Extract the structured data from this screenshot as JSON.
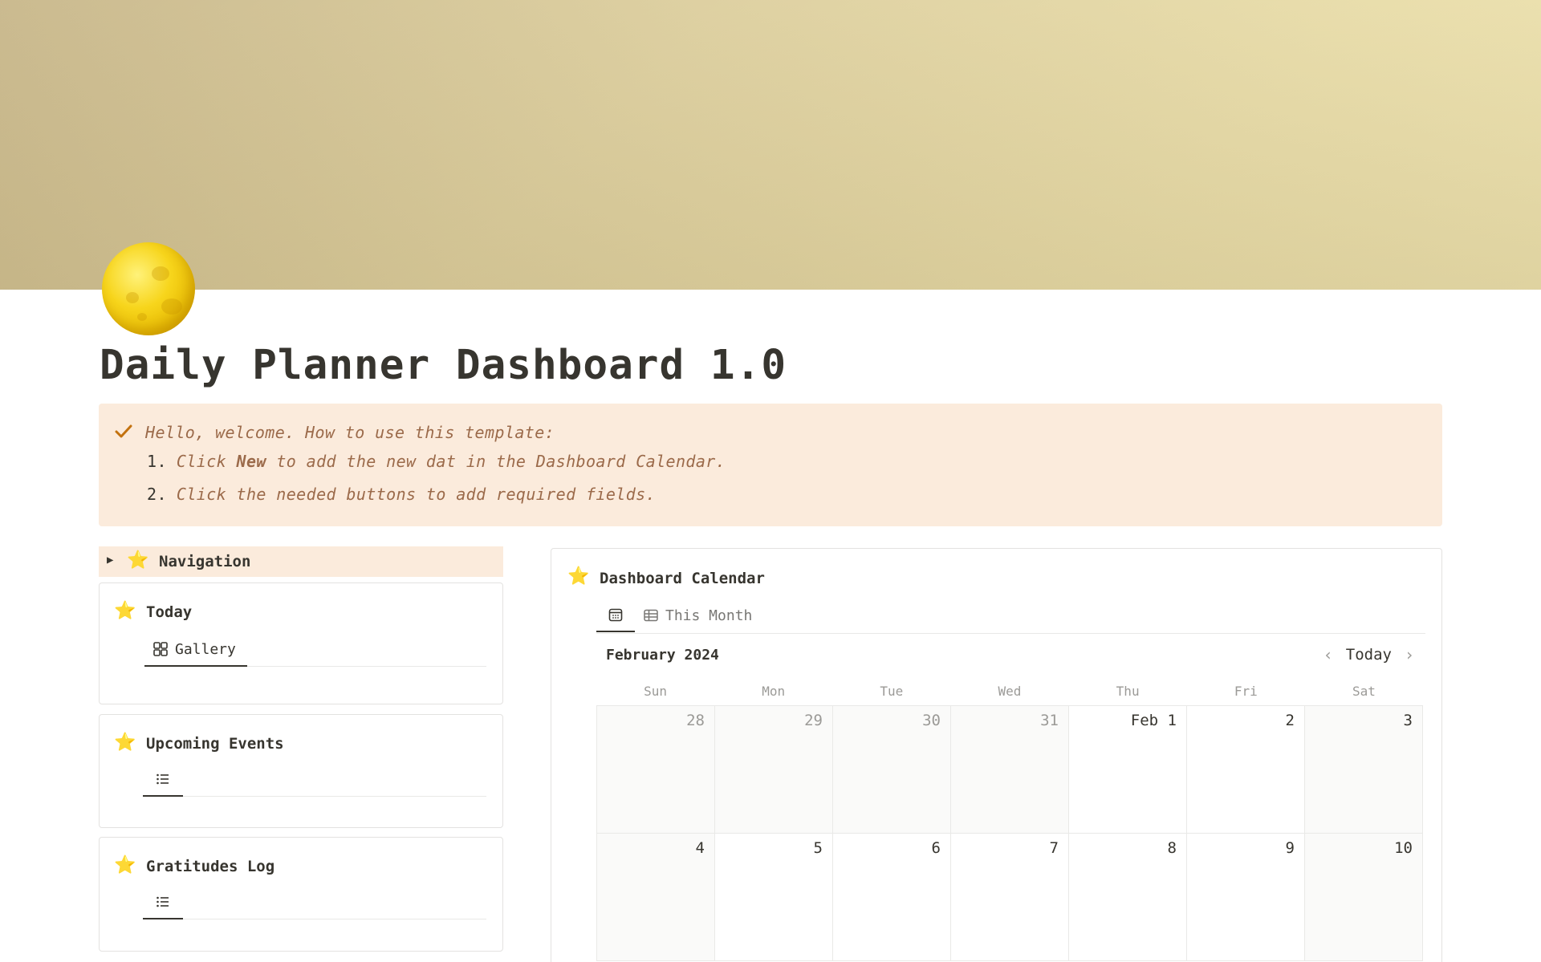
{
  "page": {
    "title": "Daily Planner Dashboard 1.0",
    "icon": "full-moon-icon"
  },
  "callout": {
    "icon": "checkmark-icon",
    "intro": "Hello, welcome. How to use this template:",
    "steps": [
      {
        "num": "1.",
        "before": "Click ",
        "bold": "New",
        "after": " to add the new dat in the Dashboard Calendar."
      },
      {
        "num": "2.",
        "text": "Click the needed buttons to add required fields."
      }
    ]
  },
  "navigation": {
    "label": "Navigation",
    "icon": "star-icon"
  },
  "sections": {
    "today": {
      "title": "Today",
      "tab_label": "Gallery",
      "tab_icon": "gallery-icon"
    },
    "upcoming": {
      "title": "Upcoming Events",
      "tab_icon": "list-icon"
    },
    "gratitudes": {
      "title": "Gratitudes Log",
      "tab_icon": "list-icon"
    }
  },
  "calendar": {
    "title": "Dashboard Calendar",
    "tabs": [
      {
        "icon": "calendar-icon",
        "label": ""
      },
      {
        "icon": "table-icon",
        "label": "This Month"
      }
    ],
    "month": "February 2024",
    "today_label": "Today",
    "weekdays": [
      "Sun",
      "Mon",
      "Tue",
      "Wed",
      "Thu",
      "Fri",
      "Sat"
    ],
    "weeks": [
      [
        "28",
        "29",
        "30",
        "31",
        "Feb 1",
        "2",
        "3"
      ],
      [
        "4",
        "5",
        "6",
        "7",
        "8",
        "9",
        "10"
      ]
    ],
    "muted_days": [
      "28",
      "29",
      "30",
      "31"
    ]
  },
  "colors": {
    "callout_bg": "#fbebdc",
    "callout_text": "#9b6a4a",
    "star": "#f2b516",
    "text": "#37352f"
  }
}
